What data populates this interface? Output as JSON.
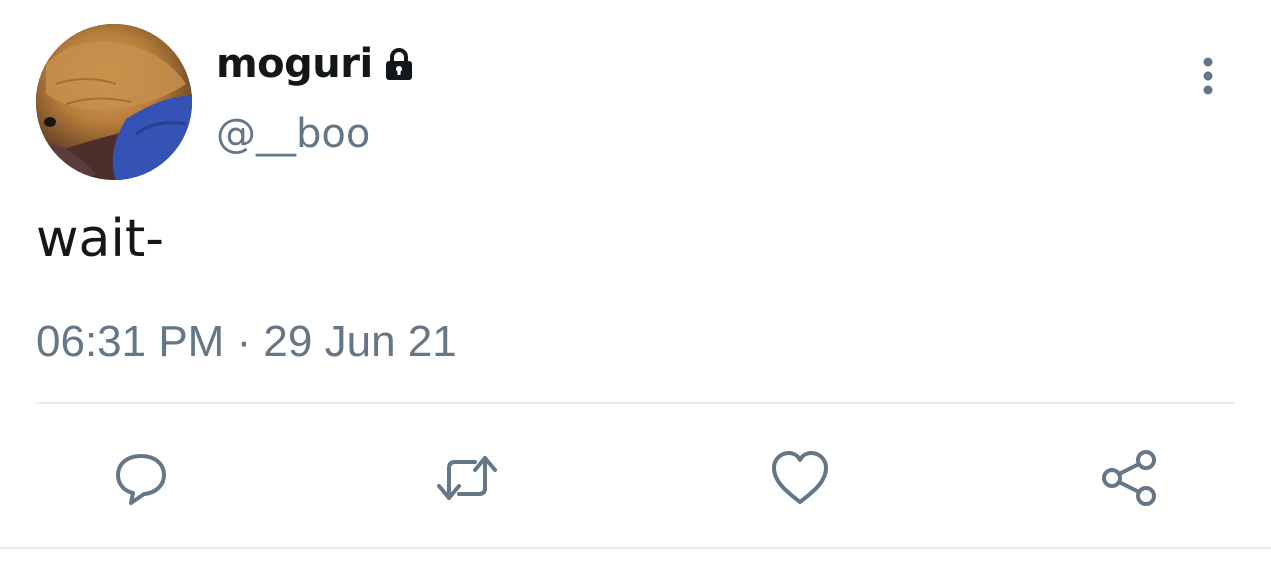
{
  "user": {
    "display_name": "moguri",
    "handle": "@__boo",
    "protected_icon": "lock-icon",
    "avatar_description": "avatar"
  },
  "tweet": {
    "text": "wait-",
    "timestamp": "06:31 PM · 29 Jun 21"
  },
  "header": {
    "more_icon": "more-vertical-icon"
  },
  "actions": [
    {
      "name": "reply",
      "icon": "reply-icon"
    },
    {
      "name": "retweet",
      "icon": "retweet-icon"
    },
    {
      "name": "like",
      "icon": "heart-icon"
    },
    {
      "name": "share",
      "icon": "share-icon"
    }
  ],
  "colors": {
    "text_primary": "#14171a",
    "text_secondary": "#657786",
    "divider": "#e6ecf0",
    "icon": "#657786"
  }
}
